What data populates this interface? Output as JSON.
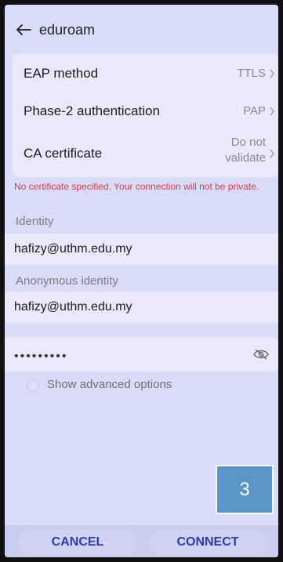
{
  "header": {
    "title": "eduroam"
  },
  "settings": {
    "eap_method": {
      "label": "EAP method",
      "value": "TTLS"
    },
    "phase2": {
      "label": "Phase-2 authentication",
      "value": "PAP"
    },
    "ca_cert": {
      "label": "CA certificate",
      "value_line1": "Do not",
      "value_line2": "validate"
    }
  },
  "warning": "No certificate specified. Your connection will not be private.",
  "identity": {
    "label": "Identity",
    "value": "hafizy@uthm.edu.my"
  },
  "anonymous_identity": {
    "label": "Anonymous identity",
    "value": "hafizy@uthm.edu.my"
  },
  "password": {
    "masked": "•••••••••"
  },
  "advanced": {
    "label": "Show advanced options",
    "checked": false
  },
  "badge": {
    "text": "3"
  },
  "actions": {
    "cancel": "CANCEL",
    "connect": "CONNECT"
  },
  "colors": {
    "accent": "#2e3aa8",
    "warning": "#d3404f",
    "badge": "#5b94c6"
  }
}
